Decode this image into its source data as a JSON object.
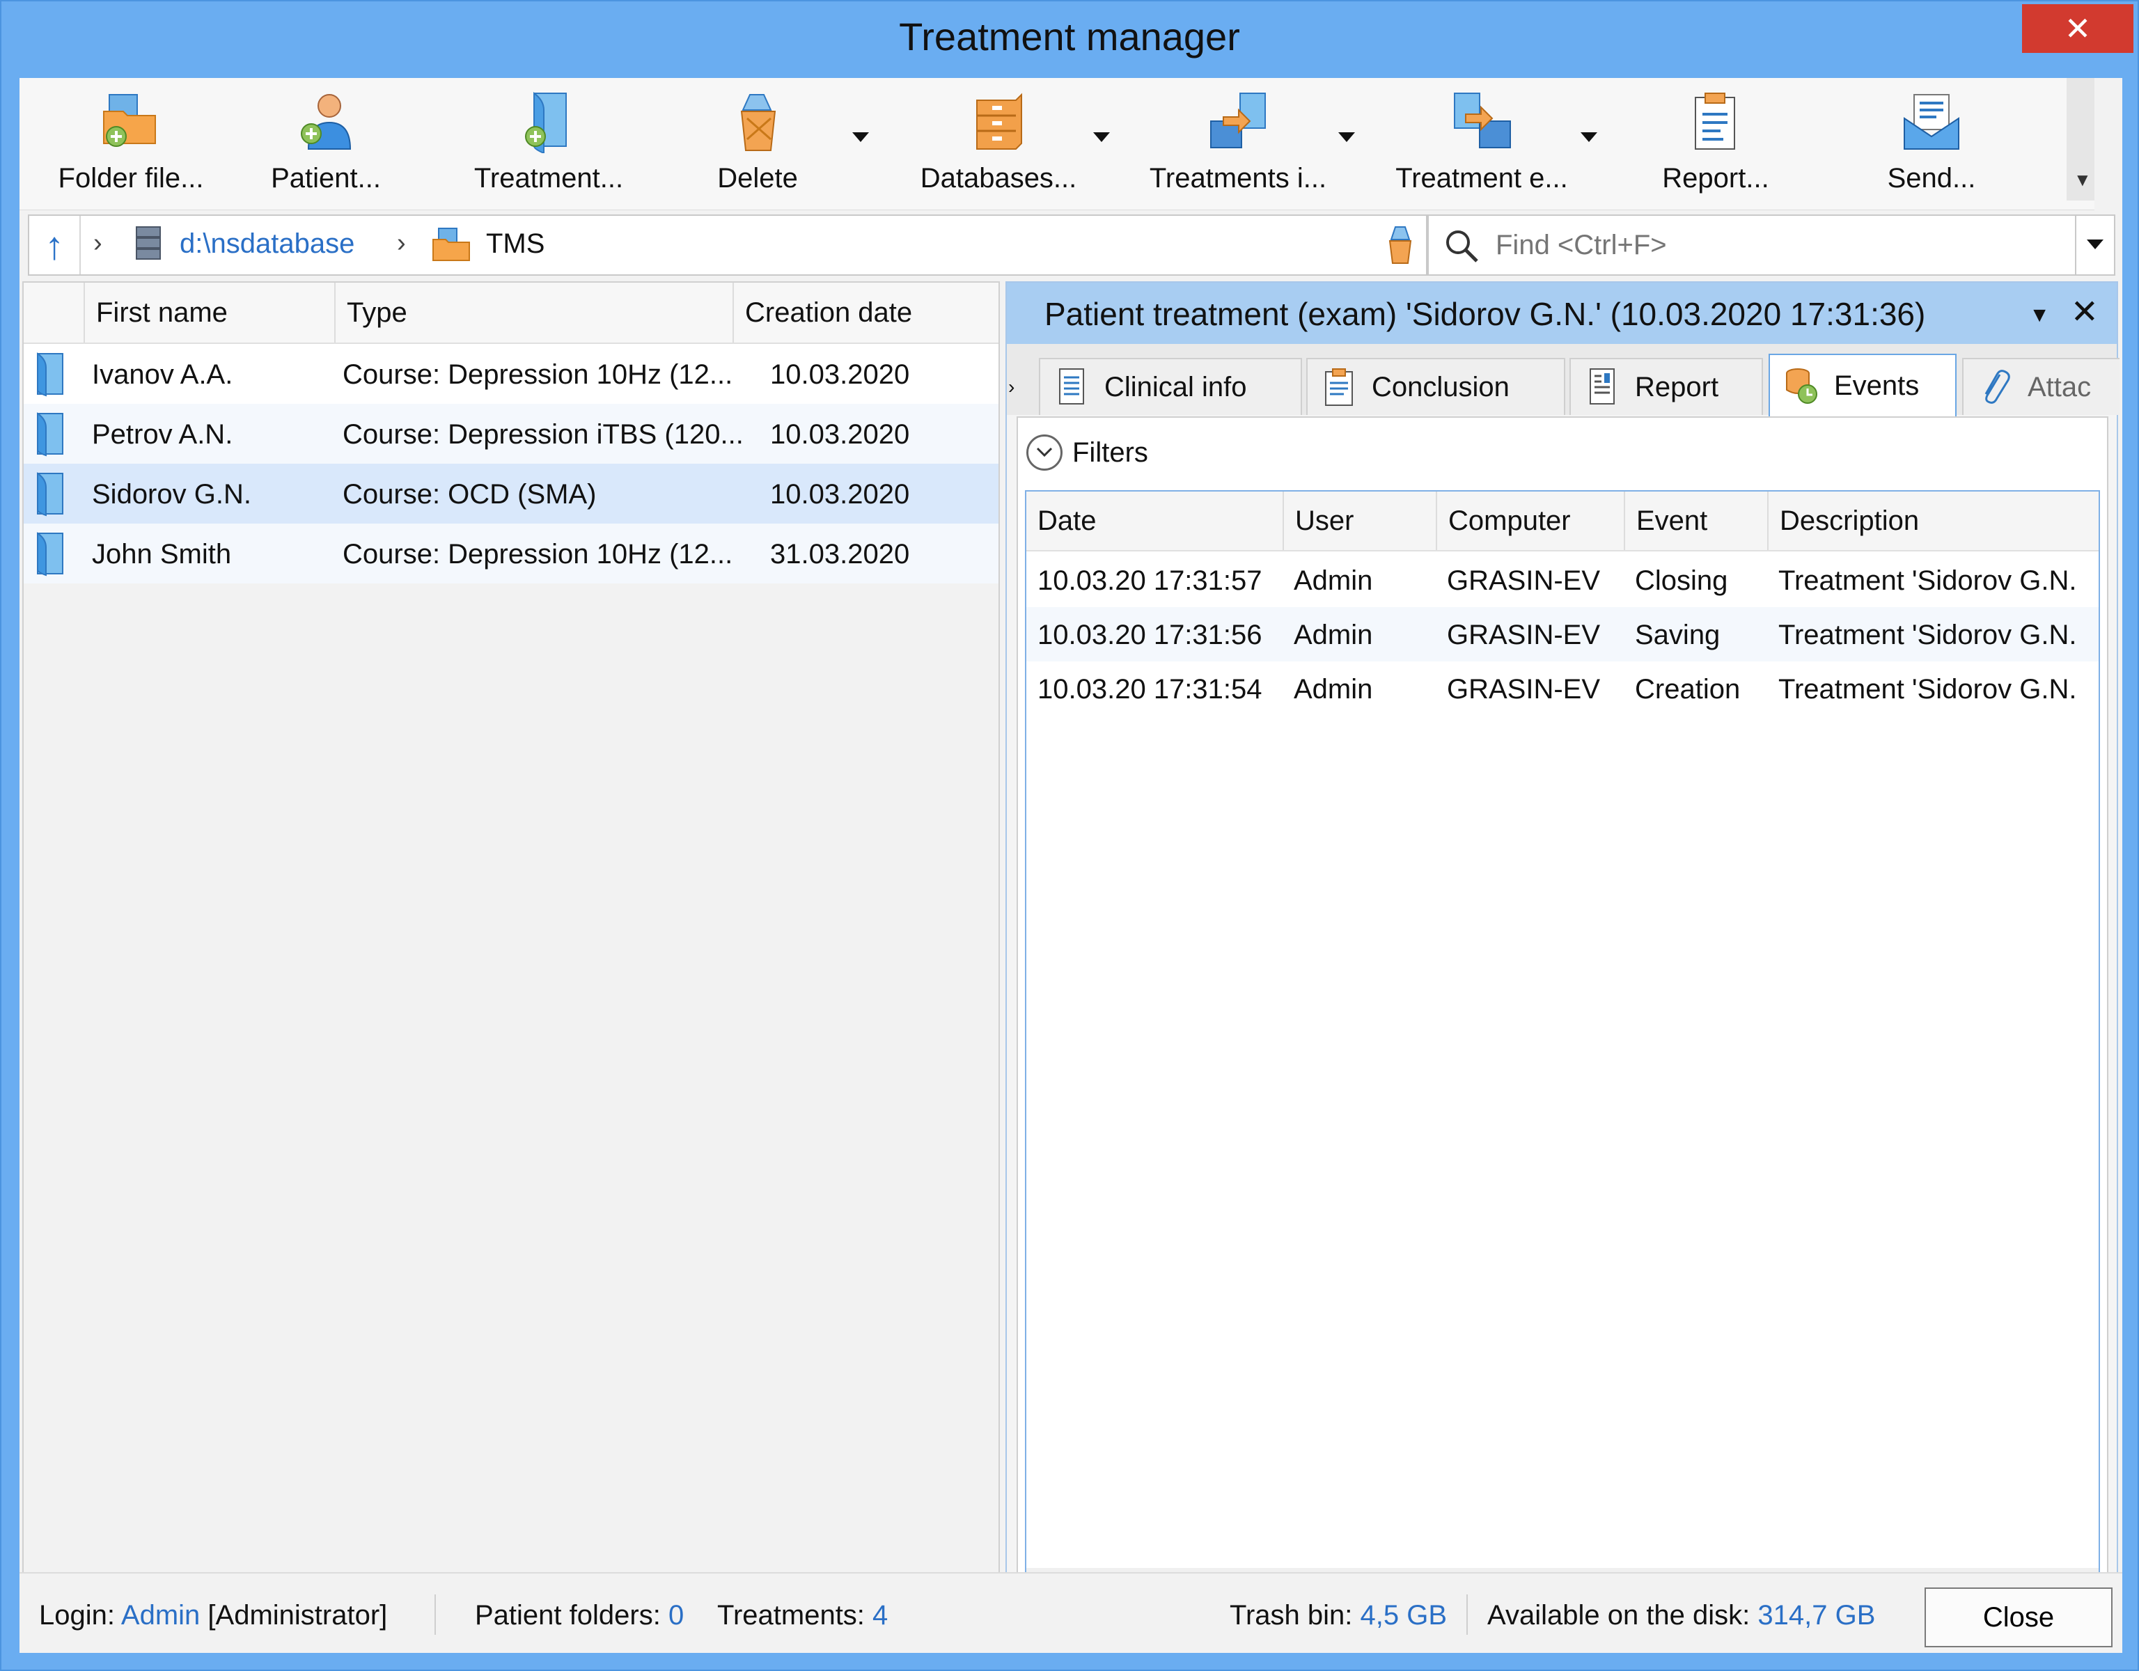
{
  "window": {
    "title": "Treatment manager",
    "close_glyph": "✕"
  },
  "toolbar": {
    "buttons": [
      {
        "label": "Folder file...",
        "icon": "folder-add-icon"
      },
      {
        "label": "Patient...",
        "icon": "patient-add-icon"
      },
      {
        "label": "Treatment...",
        "icon": "treatment-add-icon"
      },
      {
        "label": "Delete",
        "icon": "trash-icon"
      },
      {
        "label": "Databases...",
        "icon": "database-icon"
      },
      {
        "label": "Treatments i...",
        "icon": "treatments-import-icon"
      },
      {
        "label": "Treatment e...",
        "icon": "treatment-export-icon"
      },
      {
        "label": "Report...",
        "icon": "report-icon"
      },
      {
        "label": "Send...",
        "icon": "send-mail-icon"
      }
    ]
  },
  "address": {
    "path_db": "d:\\nsdatabase",
    "path_folder": "TMS"
  },
  "search": {
    "placeholder": "Find <Ctrl+F>"
  },
  "list": {
    "headers": [
      "First name",
      "Type",
      "Creation date"
    ],
    "rows": [
      {
        "name": "Ivanov A.A.",
        "type": "Course: Depression 10Hz (12...",
        "date": "10.03.2020"
      },
      {
        "name": "Petrov A.N.",
        "type": "Course: Depression iTBS (120...",
        "date": "10.03.2020"
      },
      {
        "name": "Sidorov G.N.",
        "type": "Course: OCD (SMA)",
        "date": "10.03.2020"
      },
      {
        "name": "John Smith",
        "type": "Course: Depression 10Hz (12...",
        "date": "31.03.2020"
      }
    ],
    "selected_index": 2
  },
  "detail": {
    "title": "Patient treatment (exam) 'Sidorov G.N.' (10.03.2020 17:31:36)",
    "tabs": [
      {
        "label": "Clinical info"
      },
      {
        "label": "Conclusion"
      },
      {
        "label": "Report"
      },
      {
        "label": "Events"
      },
      {
        "label": "Attac"
      }
    ],
    "active_tab": "Events",
    "filters_label": "Filters",
    "events": {
      "headers": [
        "Date",
        "User",
        "Computer",
        "Event",
        "Description"
      ],
      "rows": [
        {
          "date": "10.03.20 17:31:57",
          "user": "Admin",
          "computer": "GRASIN-EV",
          "event": "Closing",
          "description": "Treatment 'Sidorov G.N."
        },
        {
          "date": "10.03.20 17:31:56",
          "user": "Admin",
          "computer": "GRASIN-EV",
          "event": "Saving",
          "description": "Treatment 'Sidorov G.N."
        },
        {
          "date": "10.03.20 17:31:54",
          "user": "Admin",
          "computer": "GRASIN-EV",
          "event": "Creation",
          "description": "Treatment 'Sidorov G.N."
        }
      ]
    }
  },
  "status": {
    "login_label": "Login:",
    "login_user": "Admin",
    "login_role": "[Administrator]",
    "folders_label": "Patient folders:",
    "folders_value": "0",
    "treatments_label": "Treatments:",
    "treatments_value": "4",
    "trash_label": "Trash bin:",
    "trash_value": "4,5 GB",
    "disk_label": "Available on the disk:",
    "disk_value": "314,7 GB",
    "close_label": "Close"
  },
  "colors": {
    "window_frame": "#6aadf1",
    "close_button": "#d23a2f",
    "selection": "#d9e8fb",
    "link_blue": "#2a6fc6"
  }
}
